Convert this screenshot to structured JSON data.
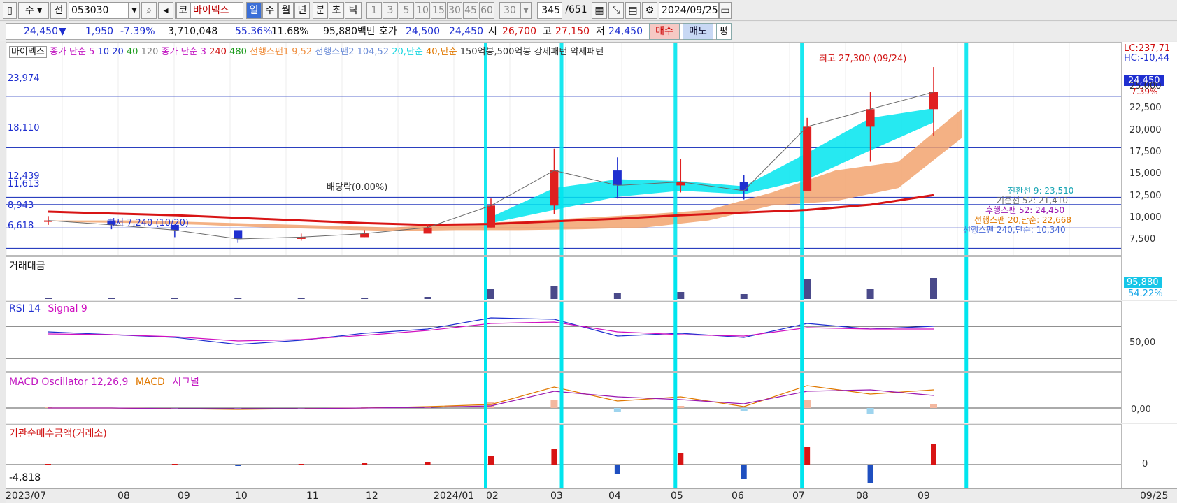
{
  "toolbar": {
    "period": "주",
    "prev": "전",
    "code": "053030",
    "market_tag": "코",
    "stock_name": "바이넥스",
    "tf_day": "일",
    "tf_week": "주",
    "tf_month": "월",
    "tf_year": "년",
    "tf_min": "분",
    "tf_sec": "초",
    "tf_tick": "틱",
    "intervals": [
      "1",
      "3",
      "5",
      "10",
      "15",
      "30",
      "45",
      "60"
    ],
    "interval_value": "30",
    "count": "345",
    "total": "/651",
    "date": "2024/09/25"
  },
  "quote": {
    "price": "24,450",
    "arrow": "▼",
    "change": "1,950",
    "change_pct": "-7.39%",
    "volume": "3,710,048",
    "ratio1": "55.36%",
    "ratio2": "11.68%",
    "amount": "95,880백만",
    "hoga_label": "호가",
    "bid": "24,500",
    "ask": "24,450",
    "open_label": "시",
    "open": "26,700",
    "high_label": "고",
    "high": "27,150",
    "low_label": "저",
    "low": "24,450",
    "buy": "매수",
    "sell": "매도",
    "eval": "평"
  },
  "legend": {
    "name": "바이넥스",
    "ma_a": "종가 단순 5",
    "ma_a10": "10",
    "ma_a20": "20",
    "ma_a40": "40",
    "ma_a120": "120",
    "ma_b": "종가 단순 3",
    "ma_b240": "240",
    "ma_b480": "480",
    "span1": "선행스팬1 9,52",
    "span2": "선행스팬2 104,52",
    "s20": "20,단순",
    "s40": "40,단순",
    "pattern": "150억봉,500억봉 강세패턴",
    "pattern2": "약세패턴"
  },
  "price_panel": {
    "hlines": [
      "23,974",
      "18,110",
      "12,439",
      "11,613",
      "8,943",
      "6,618"
    ],
    "max_label": "최고 27,300 (09/24)",
    "min_label": "최저 7,240 (10/20)",
    "dividend_label": "배당락(0.00%)",
    "lc": "LC:237,71",
    "hc": "HC:-10,44",
    "yticks": [
      "25,000",
      "22,500",
      "20,000",
      "17,500",
      "15,000",
      "12,500",
      "10,000",
      "7,500"
    ],
    "cur_price": "24,450",
    "cur_pct": "-7.39%",
    "indicators": [
      "전환선 9: 23,510",
      "기준선 52: 21,410",
      "후행스팬 52: 24,450",
      "선행스팬 20,단순: 22,668",
      "선행스팬 240,단순: 10,340"
    ],
    "colors": {
      "up": "#e02020",
      "down": "#1f2fd0",
      "cloud": "#f2a36f",
      "cyan": "#00e5ee",
      "ma240": "#d81414"
    }
  },
  "amount_panel": {
    "title": "거래대금",
    "value": "95,880",
    "pct": "54.22%"
  },
  "rsi_panel": {
    "title": "RSI 14",
    "signal": "Signal 9",
    "ytick": "50,00"
  },
  "macd_panel": {
    "title": "MACD Oscillator 12,26,9",
    "macd": "MACD",
    "signal": "시그널",
    "ytick": "0,00"
  },
  "inst_panel": {
    "title": "기관순매수금액(거래소)",
    "value": "-4,818",
    "ytick": "0"
  },
  "xaxis": {
    "labels": [
      "2023/07",
      "08",
      "09",
      "10",
      "11",
      "12",
      "2024/01",
      "02",
      "03",
      "04",
      "05",
      "06",
      "07",
      "08",
      "09"
    ],
    "right": "09/25"
  },
  "chart_data": {
    "type": "candlestick",
    "title": "바이넥스",
    "x": [
      "2023/07",
      "2023/08",
      "2023/09",
      "2023/10",
      "2023/11",
      "2023/12",
      "2024/01",
      "2024/02",
      "2024/03",
      "2024/04",
      "2024/05",
      "2024/06",
      "2024/07",
      "2024/08",
      "2024/09"
    ],
    "close": [
      9800,
      9300,
      8700,
      7700,
      7900,
      8300,
      9000,
      11500,
      15500,
      13800,
      14200,
      13200,
      20500,
      22500,
      24450
    ],
    "high": [
      10300,
      9800,
      9300,
      8600,
      8300,
      8700,
      9400,
      12300,
      18000,
      17000,
      16800,
      15000,
      21500,
      24500,
      27300
    ],
    "low": [
      9300,
      8800,
      7900,
      7240,
      7500,
      7900,
      8500,
      9000,
      10500,
      12300,
      13000,
      12200,
      13800,
      16500,
      19500
    ],
    "ylim": [
      6500,
      28500
    ],
    "annotations": {
      "max": 27300,
      "min": 7240
    }
  }
}
